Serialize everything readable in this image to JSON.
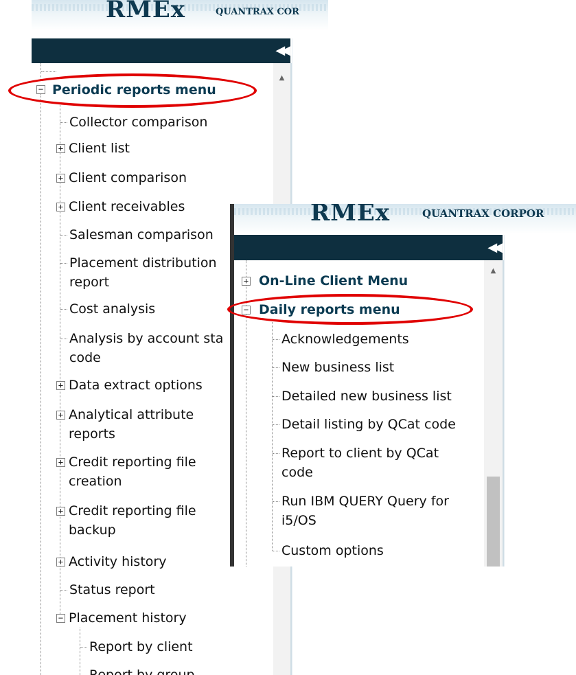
{
  "panel1": {
    "logo": "RMEx",
    "company": "QUANTRAX COR",
    "collapse_icon": "double-left-chevron",
    "tree": {
      "section_label": "Periodic reports menu",
      "items": [
        {
          "label": "Collector comparison"
        },
        {
          "label": "Client list"
        },
        {
          "label": "Client comparison"
        },
        {
          "label": "Client receivables"
        },
        {
          "label": "Salesman comparison"
        },
        {
          "label_line1": "Placement distribution",
          "label_line2": "report"
        },
        {
          "label": "Cost analysis"
        },
        {
          "label_line1": "Analysis by account sta",
          "label_line2": "code"
        },
        {
          "label": "Data extract options"
        },
        {
          "label_line1": "Analytical attribute",
          "label_line2": "reports"
        },
        {
          "label_line1": "Credit reporting file",
          "label_line2": "creation"
        },
        {
          "label_line1": "Credit reporting file",
          "label_line2": "backup"
        },
        {
          "label": "Activity history"
        },
        {
          "label": "Status report"
        },
        {
          "label": "Placement history"
        }
      ],
      "sub_items": [
        {
          "label": "Report by client"
        },
        {
          "label": "Report by group"
        }
      ]
    }
  },
  "panel2": {
    "logo": "RMEx",
    "company": "QUANTRAX CORPOR",
    "collapse_icon": "double-left-chevron",
    "tree": {
      "top_section": "On-Line Client Menu",
      "section_label": "Daily reports menu",
      "items": [
        {
          "label": "Acknowledgements"
        },
        {
          "label": "New business list"
        },
        {
          "label": "Detailed new business list"
        },
        {
          "label": "Detail listing by QCat code"
        },
        {
          "label_line1": "Report to client by QCat",
          "label_line2": "code"
        },
        {
          "label_line1": "Run IBM QUERY Query for",
          "label_line2": "i5/OS"
        },
        {
          "label": "Custom options"
        }
      ]
    }
  },
  "highlight_color": "#e00000"
}
